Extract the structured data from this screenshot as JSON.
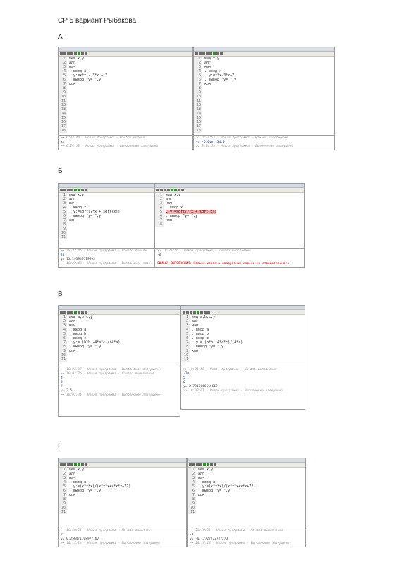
{
  "title": "СР 5 вариант Рыбакова",
  "sections": [
    "А",
    "Б",
    "В",
    "Г"
  ],
  "shots": {
    "a_left": {
      "lines": [
        "вещ x,y",
        "алг",
        "нач",
        ". ввод x",
        ". y:=x*x - 3*x + 7",
        ". вывод \"y= \",y",
        "кон"
      ],
      "output": [
        ">> 0:24:40 - Новая программа - Начало выполн",
        "x= ",
        ">> 0:24:52 - Новая программа - Выполнение завершено"
      ]
    },
    "a_right": {
      "lines": [
        "вещ x,y",
        "алг",
        "нач",
        ". ввод x",
        ". y:=x*x-3*x+7",
        ". вывод \"y= \",y",
        "кон"
      ],
      "output": [
        ">> 0:24:52 - Новая программа - Начало выполнения",
        "y= -6.0ye 134.0",
        ">> 0:24:53 - Новая программа - Выполнение завершено"
      ]
    },
    "b_left": {
      "lines": [
        "вещ x,y",
        "алг",
        "нач",
        ". ввод x",
        ". y:=sqrt(7*x + sqrt(x))",
        ". вывод \"y= \",y",
        "кон"
      ],
      "output": [
        ">> 18:33:46 - Новая программа - Начало выполн",
        "24",
        "y= 13.291945519595",
        ">> 18:33:48 - Новая программа - Выполнение заве"
      ]
    },
    "b_right": {
      "lines": [
        "вещ x,y",
        "алг",
        "нач",
        ". ввод x",
        ". y:=sqrt(7*x + sqrt(x))",
        ". вывод \"y= \",y",
        "кон"
      ],
      "output": [
        ">> 18:35:56 - Новая программа - Начало выполнения",
        "-6",
        "ОШИБКА ВЫПОЛНЕНИЯ: Нельзя извлечь квадратный корень из отрицательного"
      ]
    },
    "v_left": {
      "lines": [
        "вещ a,b,c,y",
        "алг",
        "нач",
        ". ввод a",
        ". ввод b",
        ". ввод c",
        ". y:= (b*b -4*a*c)/(4*a)",
        ". вывод \"y= \",y",
        "кон"
      ],
      "output": [
        ">> 18:07:17 - Новая программа - Выполнение завершено",
        ">> 18:07:26 - Новая программа - Начало выполнения",
        "4",
        "3",
        "7",
        "y= 2.5",
        ">> 18:07:34 - Новая программа - Выполнение завершено"
      ]
    },
    "v_right": {
      "lines": [
        "вещ a,b,c,y",
        "алг",
        "нач",
        ". ввод a",
        ". ввод b",
        ". ввод c",
        ". y:= (b*b -4*a*c)/(4*a)",
        ". вывод \"y= \",y",
        "кон"
      ],
      "output": [
        ">> 18:01:55 - Новая программа - Начало выполнения",
        "-10",
        "5",
        "6",
        "y= 2.7916666666667",
        ">> 18:02:01 - Новая программа - Выполнение завершено"
      ]
    },
    "g_left": {
      "lines": [
        "вещ x,y",
        "алг",
        "нач",
        ". ввод x",
        ". y:=(x*x*x)/(x*x*x+x*x*x+72)",
        ". вывод \"y= \",y",
        "кон"
      ],
      "output": [
        ">> 18:18:16 - Новая программа - Начало выполнен",
        "2",
        "y= 0.2564/1.0897/767",
        ">> 18:17:14 - Новая программа - Выполнение завершено"
      ]
    },
    "g_right": {
      "lines": [
        "вещ x,y",
        "алг",
        "нач",
        ". ввод x",
        ". y:=(x*x*x)/(x*x*x+x*x+72)",
        ". вывод \"y= \",y",
        "кон"
      ],
      "output": [
        ">> 18:18:16 - Новая программа - Начало выполнения",
        "-3",
        "y= -0.12727272727273",
        ">> 18:18:18 - Новая программа - Выполнение завершено"
      ]
    }
  }
}
